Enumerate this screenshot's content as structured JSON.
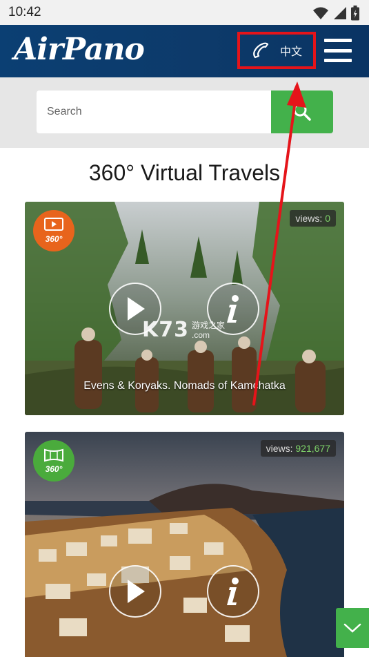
{
  "status_bar": {
    "time": "10:42"
  },
  "header": {
    "logo_text": "AirPano",
    "language_label": "中文"
  },
  "search": {
    "placeholder": "Search"
  },
  "page": {
    "title": "360° Virtual Travels"
  },
  "cards": [
    {
      "badge_text": "360°",
      "badge_color": "#e8641c",
      "views_label": "views:",
      "views_count": "0",
      "caption": "Evens & Koryaks. Nomads of Kamchatka"
    },
    {
      "badge_text": "360°",
      "badge_color": "#4aab3c",
      "views_label": "views:",
      "views_count": "921,677"
    }
  ],
  "watermark": {
    "main": "K73",
    "sub_top": "游戏之家",
    "sub_bottom": ".com"
  },
  "colors": {
    "header_bg": "#0b3f73",
    "accent_green": "#43b14b",
    "annotation_red": "#e5141a"
  },
  "icons": [
    "wifi-icon",
    "signal-icon",
    "battery-icon",
    "phone-icon",
    "menu-icon",
    "search-icon",
    "play-icon",
    "info-icon",
    "video-360-icon",
    "panorama-360-icon",
    "chevron-down-icon"
  ]
}
